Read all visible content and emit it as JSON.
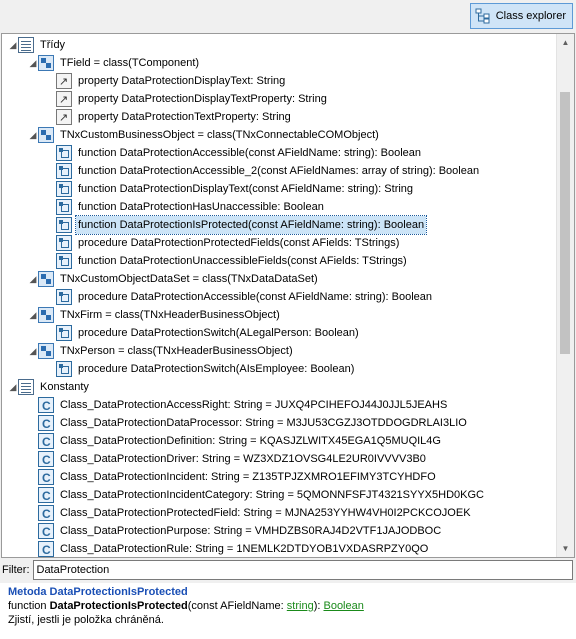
{
  "toolbar": {
    "class_explorer_label": "Class explorer"
  },
  "tree": {
    "rows": [
      {
        "text": "Třídy",
        "icon": "doc",
        "indent": 0,
        "expanded": true
      },
      {
        "text": "TField = class(TComponent)",
        "icon": "class",
        "indent": 1,
        "expanded": true
      },
      {
        "text": "property DataProtectionDisplayText: String",
        "icon": "prop",
        "indent": 2
      },
      {
        "text": "property DataProtectionDisplayTextProperty: String",
        "icon": "prop",
        "indent": 2
      },
      {
        "text": "property DataProtectionTextProperty: String",
        "icon": "prop",
        "indent": 2
      },
      {
        "text": "TNxCustomBusinessObject = class(TNxConnectableCOMObject)",
        "icon": "class",
        "indent": 1,
        "expanded": true
      },
      {
        "text": "function DataProtectionAccessible(const AFieldName: string): Boolean",
        "icon": "method",
        "indent": 2
      },
      {
        "text": "function DataProtectionAccessible_2(const AFieldNames: array of string): Boolean",
        "icon": "method",
        "indent": 2
      },
      {
        "text": "function DataProtectionDisplayText(const AFieldName: string): String",
        "icon": "method",
        "indent": 2
      },
      {
        "text": "function DataProtectionHasUnaccessible: Boolean",
        "icon": "method",
        "indent": 2
      },
      {
        "text": "function DataProtectionIsProtected(const AFieldName: string): Boolean",
        "icon": "method",
        "indent": 2,
        "selected": true
      },
      {
        "text": "procedure DataProtectionProtectedFields(const AFields: TStrings)",
        "icon": "method",
        "indent": 2
      },
      {
        "text": "function DataProtectionUnaccessibleFields(const AFields: TStrings)",
        "icon": "method",
        "indent": 2
      },
      {
        "text": "TNxCustomObjectDataSet = class(TNxDataDataSet)",
        "icon": "class",
        "indent": 1,
        "expanded": true
      },
      {
        "text": "procedure DataProtectionAccessible(const AFieldName: string): Boolean",
        "icon": "method",
        "indent": 2
      },
      {
        "text": "TNxFirm = class(TNxHeaderBusinessObject)",
        "icon": "class",
        "indent": 1,
        "expanded": true
      },
      {
        "text": "procedure DataProtectionSwitch(ALegalPerson: Boolean)",
        "icon": "method",
        "indent": 2
      },
      {
        "text": "TNxPerson = class(TNxHeaderBusinessObject)",
        "icon": "class",
        "indent": 1,
        "expanded": true
      },
      {
        "text": "procedure DataProtectionSwitch(AIsEmployee: Boolean)",
        "icon": "method",
        "indent": 2
      },
      {
        "text": "Konstanty",
        "icon": "doc",
        "indent": 0,
        "expanded": true
      },
      {
        "text": "Class_DataProtectionAccessRight: String = JUXQ4PCIHEFOJ44J0JJL5JEAHS",
        "icon": "const",
        "indent": 1
      },
      {
        "text": "Class_DataProtectionDataProcessor: String = M3JU53CGZJ3OTDDOGDRLAI3LIO",
        "icon": "const",
        "indent": 1
      },
      {
        "text": "Class_DataProtectionDefinition: String = KQASJZLWITX45EGA1Q5MUQIL4G",
        "icon": "const",
        "indent": 1
      },
      {
        "text": "Class_DataProtectionDriver: String = WZ3XDZ1OVSG4LE2UR0IVVVV3B0",
        "icon": "const",
        "indent": 1
      },
      {
        "text": "Class_DataProtectionIncident: String = Z135TPJZXMRO1EFIMY3TCYHDFO",
        "icon": "const",
        "indent": 1
      },
      {
        "text": "Class_DataProtectionIncidentCategory: String = 5QMONNFSFJT4321SYYX5HD0KGC",
        "icon": "const",
        "indent": 1
      },
      {
        "text": "Class_DataProtectionProtectedField: String = MJNA253YYHW4VH0I2PCKCOJOEK",
        "icon": "const",
        "indent": 1
      },
      {
        "text": "Class_DataProtectionPurpose: String = VMHDZBS0RAJ4D2VTF1JAJODBOC",
        "icon": "const",
        "indent": 1
      },
      {
        "text": "Class_DataProtectionRule: String = 1NEMLK2DTDYOB1VXDASRPZY0QO",
        "icon": "const",
        "indent": 1
      }
    ]
  },
  "filter": {
    "label": "Filter:",
    "value": "DataProtection"
  },
  "info": {
    "title": "Metoda DataProtectionIsProtected",
    "sig_prefix": "function ",
    "sig_name": "DataProtectionIsProtected",
    "sig_params": "(const AFieldName: ",
    "sig_type": "string",
    "sig_mid": "): ",
    "sig_return": "Boolean",
    "description": "Zjistí, jestli je položka chráněná."
  }
}
